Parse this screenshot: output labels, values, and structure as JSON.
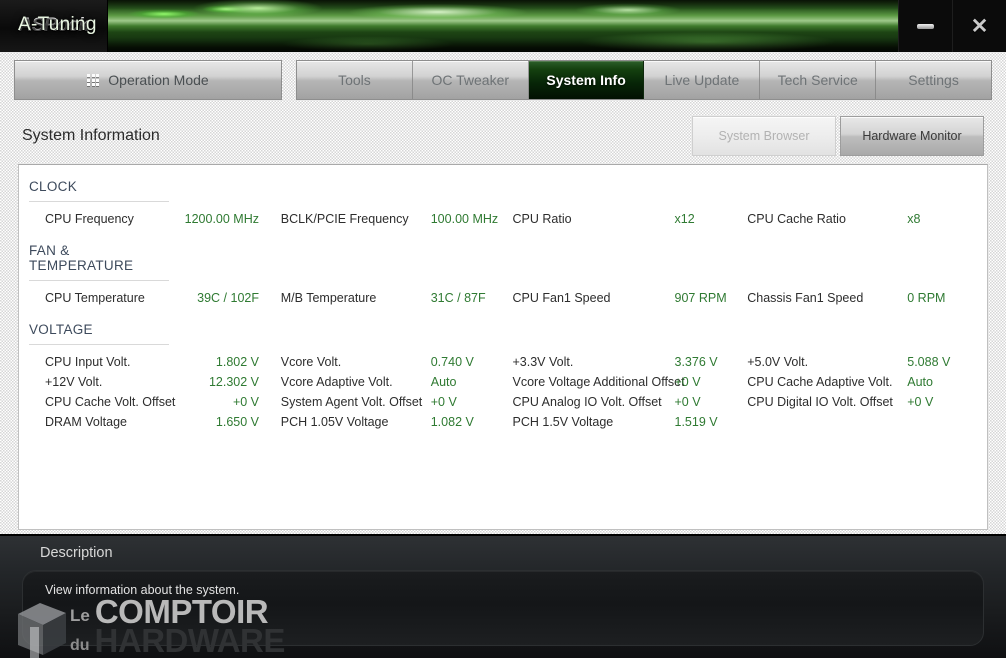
{
  "window": {
    "brand_logo": "ASRock",
    "app_title": "A-Tuning",
    "minimize_label": "–",
    "close_label": "✕"
  },
  "nav": {
    "operation_mode": "Operation Mode",
    "operation_mode_icon": "grid-icon",
    "tabs": [
      {
        "label": "Tools",
        "active": false
      },
      {
        "label": "OC Tweaker",
        "active": false
      },
      {
        "label": "System Info",
        "active": true
      },
      {
        "label": "Live Update",
        "active": false
      },
      {
        "label": "Tech Service",
        "active": false
      },
      {
        "label": "Settings",
        "active": false
      }
    ]
  },
  "panel": {
    "title": "System Information",
    "buttons": [
      {
        "label": "System Browser",
        "state": "disabled"
      },
      {
        "label": "Hardware Monitor",
        "state": "active"
      }
    ]
  },
  "sections": [
    {
      "title": "CLOCK",
      "rows": [
        [
          {
            "label": "CPU Frequency",
            "value": "1200.00 MHz"
          },
          {
            "label": "BCLK/PCIE Frequency",
            "value": "100.00 MHz"
          },
          {
            "label": "CPU Ratio",
            "value": "x12"
          },
          {
            "label": "CPU Cache Ratio",
            "value": "x8"
          }
        ]
      ]
    },
    {
      "title": "FAN & TEMPERATURE",
      "rows": [
        [
          {
            "label": "CPU Temperature",
            "value": "39C / 102F"
          },
          {
            "label": "M/B Temperature",
            "value": "31C / 87F"
          },
          {
            "label": "CPU Fan1 Speed",
            "value": "907 RPM"
          },
          {
            "label": "Chassis Fan1 Speed",
            "value": "0 RPM"
          }
        ]
      ]
    },
    {
      "title": "VOLTAGE",
      "rows": [
        [
          {
            "label": "CPU Input Volt.",
            "value": "1.802 V"
          },
          {
            "label": "Vcore Volt.",
            "value": "0.740 V"
          },
          {
            "label": "+3.3V Volt.",
            "value": "3.376 V"
          },
          {
            "label": "+5.0V Volt.",
            "value": "5.088 V"
          }
        ],
        [
          {
            "label": "+12V Volt.",
            "value": "12.302 V"
          },
          {
            "label": "Vcore Adaptive Volt.",
            "value": "Auto"
          },
          {
            "label": "Vcore Voltage Additional Offset",
            "value": "+0 V"
          },
          {
            "label": "CPU Cache Adaptive Volt.",
            "value": "Auto"
          }
        ],
        [
          {
            "label": "CPU Cache Volt. Offset",
            "value": "+0 V"
          },
          {
            "label": " System Agent Volt. Offset",
            "value": "+0 V"
          },
          {
            "label": "CPU Analog IO Volt. Offset",
            "value": "+0 V"
          },
          {
            "label": "CPU Digital IO Volt. Offset",
            "value": "+0 V"
          }
        ],
        [
          {
            "label": "DRAM Voltage",
            "value": "1.650 V"
          },
          {
            "label": "PCH 1.05V Voltage",
            "value": "1.082 V"
          },
          {
            "label": "PCH 1.5V Voltage",
            "value": "1.519 V"
          },
          {
            "label": "",
            "value": ""
          }
        ]
      ]
    }
  ],
  "description": {
    "title": "Description",
    "text": "View information about the system."
  },
  "watermark": {
    "le": "Le",
    "comptoir": "COMPTOIR",
    "du": "du",
    "hardware": "HARDWARE"
  },
  "colors": {
    "value_green": "#2f7a32",
    "active_tab_green": "#14400f",
    "section_head": "#3d4a5c"
  }
}
